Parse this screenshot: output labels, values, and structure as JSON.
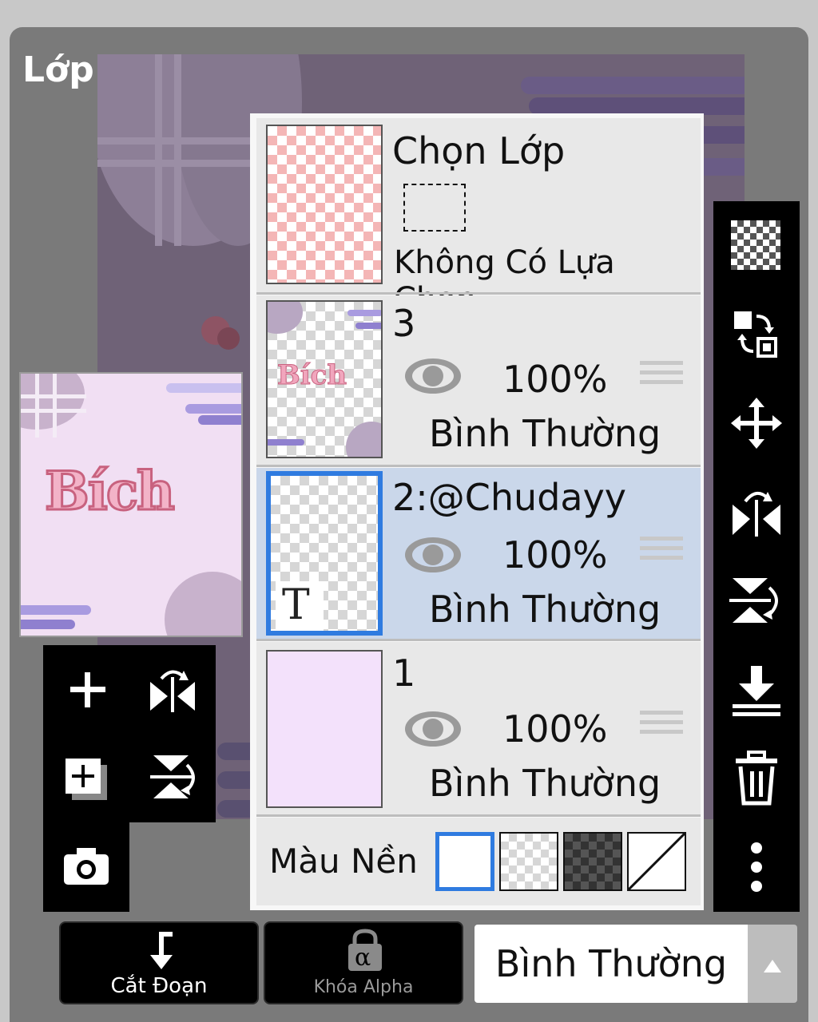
{
  "panel": {
    "title": "Lớp"
  },
  "selection_row": {
    "title": "Chọn Lớp",
    "status": "Không Có Lựa Chọn"
  },
  "layers": [
    {
      "name": "3",
      "opacity": "100%",
      "blend": "Bình Thường",
      "selected": false,
      "visible": true
    },
    {
      "name": "2:@Chudayy",
      "opacity": "100%",
      "blend": "Bình Thường",
      "selected": true,
      "visible": true,
      "type_badge": "T"
    },
    {
      "name": "1",
      "opacity": "100%",
      "blend": "Bình Thường",
      "selected": false,
      "visible": true
    }
  ],
  "background_color": {
    "label": "Màu Nền",
    "options": [
      "white",
      "transparent",
      "dark-checker",
      "none"
    ],
    "selected": "white"
  },
  "preview": {
    "art_text": "Bích"
  },
  "bottom_bar": {
    "clipping_label": "Cắt Đoạn",
    "alpha_lock_label": "Khóa Alpha",
    "alpha_glyph": "α",
    "blend_mode": "Bình Thường"
  },
  "icons": {
    "left_tools": [
      "add-layer-icon",
      "flip-horizontal-icon",
      "add-layer-copy-icon",
      "flip-vertical-icon",
      "camera-icon"
    ],
    "right_tools": [
      "transparent-fill-icon",
      "swap-icon",
      "move-icon",
      "flip-horizontal-icon",
      "flip-vertical-icon",
      "merge-down-icon",
      "trash-icon",
      "more-icon"
    ]
  },
  "colors": {
    "accent": "#2f7be0",
    "selected_row": "#cad7ea",
    "panel_bg": "#7a7a7a",
    "toolbar_bg": "#000000"
  }
}
